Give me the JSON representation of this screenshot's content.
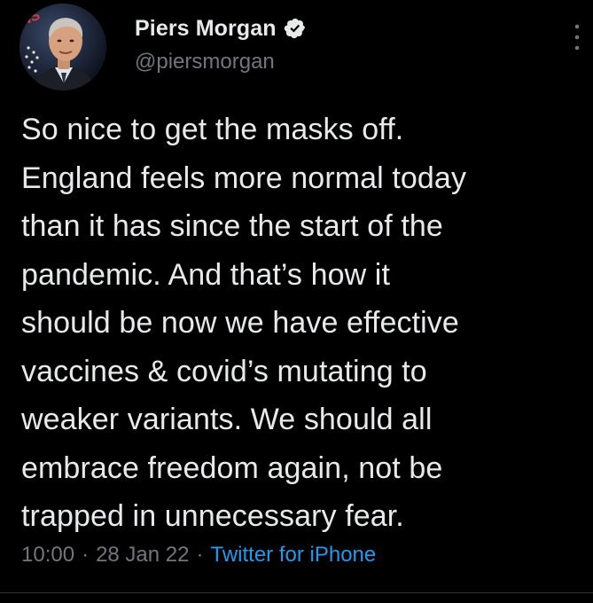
{
  "tweet": {
    "author": {
      "display_name": "Piers Morgan",
      "handle": "@piersmorgan",
      "verified": true,
      "avatar_icon": "avatar-photo"
    },
    "text": "So nice to get the masks off.\nEngland feels more normal today\nthan it has since the start of the\npandemic. And that’s how it\nshould be now we have effective\nvaccines & covid’s mutating to\nweaker variants. We should all\nembrace freedom again, not be\ntrapped in unnecessary fear.",
    "time": "10:00",
    "separator": "·",
    "date": "28 Jan 22",
    "source": "Twitter for iPhone"
  },
  "colors": {
    "background": "#000000",
    "text_primary": "#e7e9ea",
    "text_secondary": "#71767b",
    "link": "#1d9bf0",
    "divider": "#2f3336"
  },
  "icons": {
    "verified": "verified-badge-icon",
    "more": "more-options-icon"
  }
}
